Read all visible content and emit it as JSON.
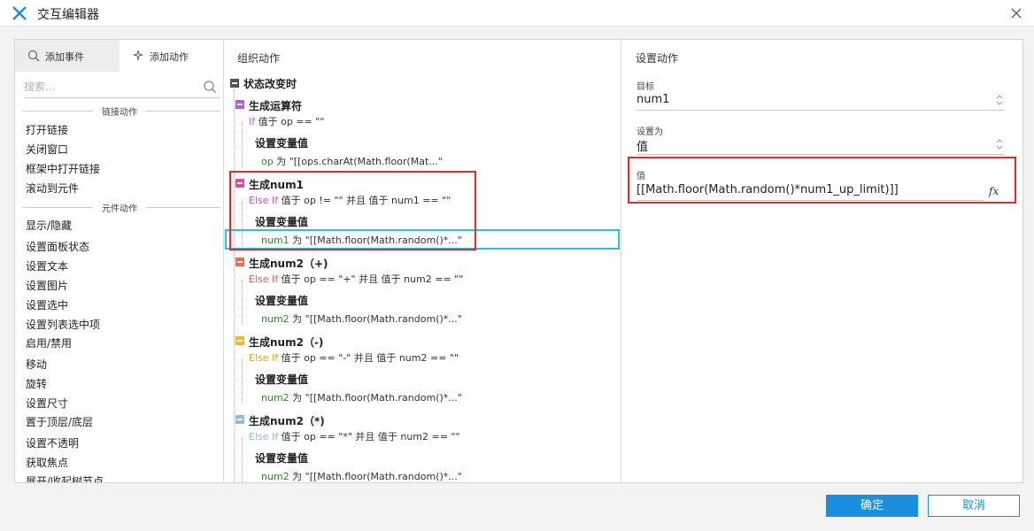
{
  "window": {
    "title": "交互编辑器"
  },
  "left": {
    "tabs": {
      "add_event": "添加事件",
      "add_action": "添加动作"
    },
    "search_placeholder": "搜索...",
    "link_group": "链接动作",
    "link_actions": [
      "打开链接",
      "关闭窗口",
      "框架中打开链接",
      "滚动到元件"
    ],
    "widget_group": "元件动作",
    "widget_actions": [
      "显示/隐藏",
      "设置面板状态",
      "设置文本",
      "设置图片",
      "设置选中",
      "设置列表选中项",
      "启用/禁用",
      "移动",
      "旋转",
      "设置尺寸",
      "置于顶层/底层",
      "设置不透明",
      "获取焦点",
      "展开/收起树节点"
    ]
  },
  "middle": {
    "header": "组织动作",
    "root": "状态改变时",
    "cases": [
      {
        "title": "生成运算符",
        "color": "#b35ce6",
        "kw": "If",
        "kw_color": "#b35ce6",
        "cond": " 值于 op == \"\"",
        "action": "设置变量值",
        "var": "op",
        "detail": " 为 \"[[ops.charAt(Math.floor(Mat...\""
      },
      {
        "title": "生成num1",
        "color": "#d94fa8",
        "kw": "Else If",
        "kw_color": "#c055c0",
        "cond": " 值于 op != \"\" 并且 值于 num1 == \"\"",
        "action": "设置变量值",
        "var": "num1",
        "detail": " 为 \"[[Math.floor(Math.random()*...\""
      },
      {
        "title": "生成num2（+)",
        "color": "#ef6b57",
        "kw": "Else If",
        "kw_color": "#e35d4f",
        "cond": " 值于 op == \"+\" 并且 值于 num2 == \"\"",
        "action": "设置变量值",
        "var": "num2",
        "detail": " 为 \"[[Math.floor(Math.random()*...\""
      },
      {
        "title": "生成num2（-)",
        "color": "#f3b92c",
        "kw": "Else If",
        "kw_color": "#e2a617",
        "cond": " 值于 op == \"-\" 并且 值于 num2 == \"\"",
        "action": "设置变量值",
        "var": "num2",
        "detail": " 为 \"[[Math.floor(Math.random()*...\""
      },
      {
        "title": "生成num2（*)",
        "color": "#8fb9e6",
        "kw": "Else If",
        "kw_color": "#8fb9e6",
        "cond": " 值于 op == \"*\" 并且 值于 num2 == \"\"",
        "action": "设置变量值",
        "var": "num2",
        "detail": " 为 \"[[Math.floor(Math.random()*...\""
      }
    ]
  },
  "right": {
    "header": "设置动作",
    "target_label": "目标",
    "target_value": "num1",
    "set_as_label": "设置为",
    "set_as_value": "值",
    "value_label": "值",
    "value": "[[Math.floor(Math.random()*num1_up_limit)]]",
    "fx": "fx"
  },
  "footer": {
    "ok": "确定",
    "cancel": "取消"
  },
  "colors": {
    "accent": "#1a8fdf",
    "highlight_red": "#e32b2b",
    "selection_cyan": "#2bc1d8",
    "var_green": "#2e8b2e"
  }
}
